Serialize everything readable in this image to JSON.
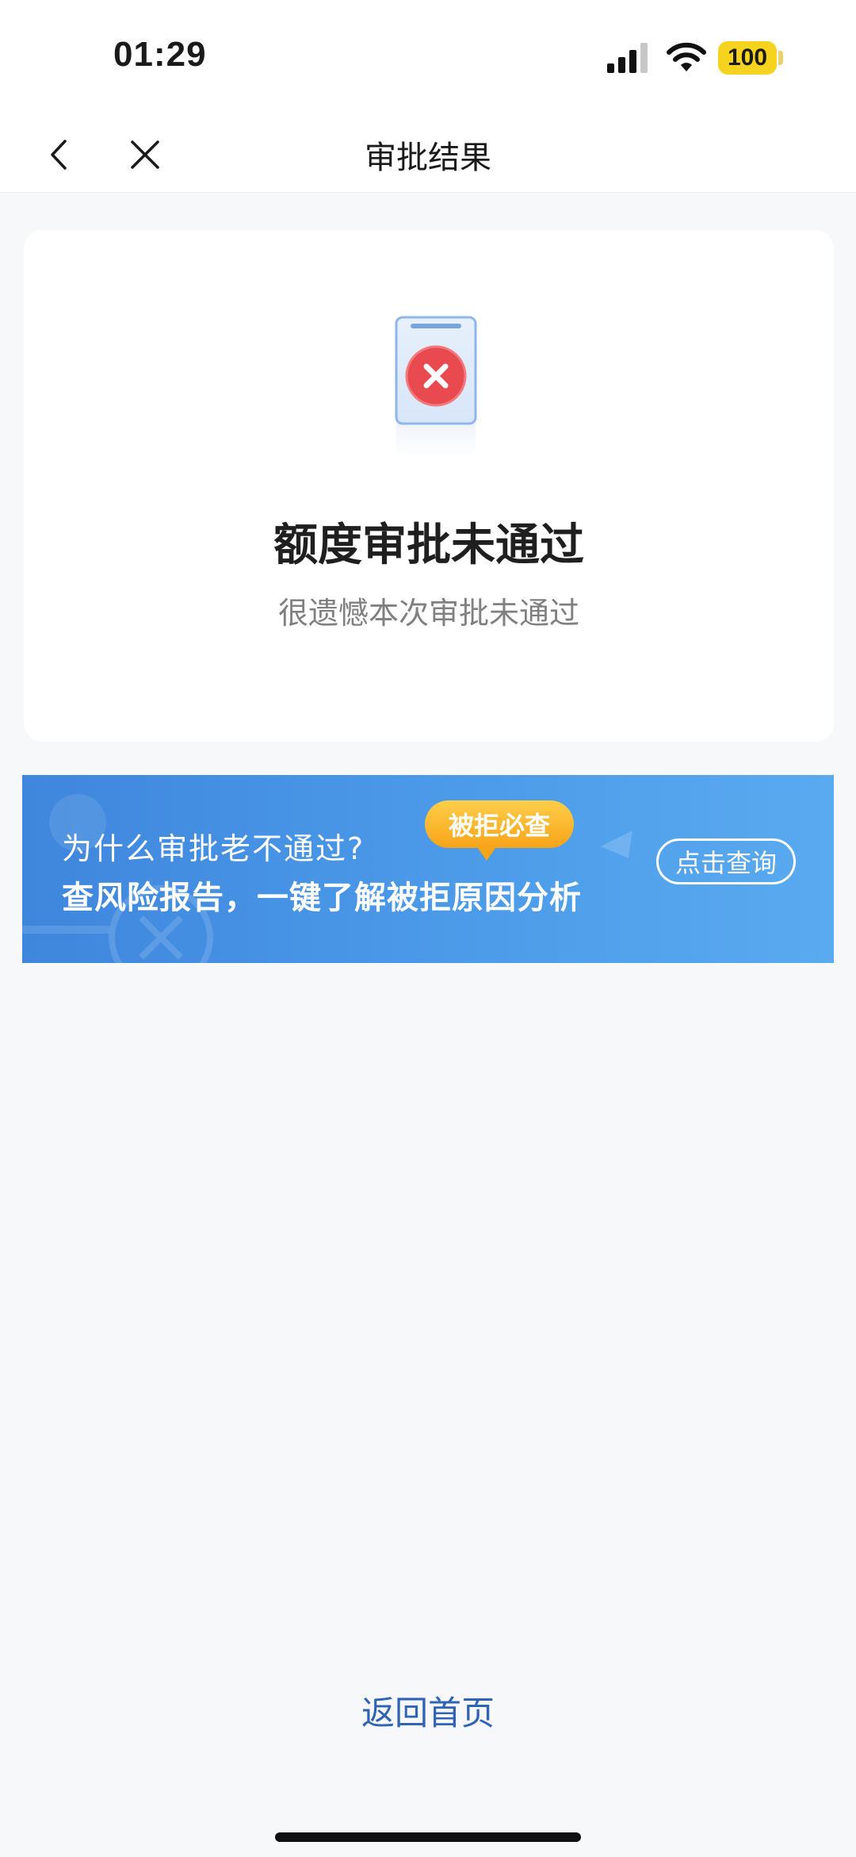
{
  "status_bar": {
    "time": "01:29",
    "battery": "100",
    "battery_color": "#f6d31e"
  },
  "nav": {
    "title": "审批结果",
    "back_icon": "chevron-left-icon",
    "close_icon": "close-icon"
  },
  "result": {
    "icon": "rejected-document-icon",
    "title": "额度审批未通过",
    "subtitle": "很遗憾本次审批未通过",
    "reject_color": "#e84a4f"
  },
  "banner": {
    "question": "为什么审批老不通过?",
    "headline": "查风险报告，一键了解被拒原因分析",
    "tag": "被拒必查",
    "button": "点击查询",
    "accent_color": "#4c9be9"
  },
  "footer": {
    "home_link": "返回首页",
    "link_color": "#2f63b8"
  }
}
